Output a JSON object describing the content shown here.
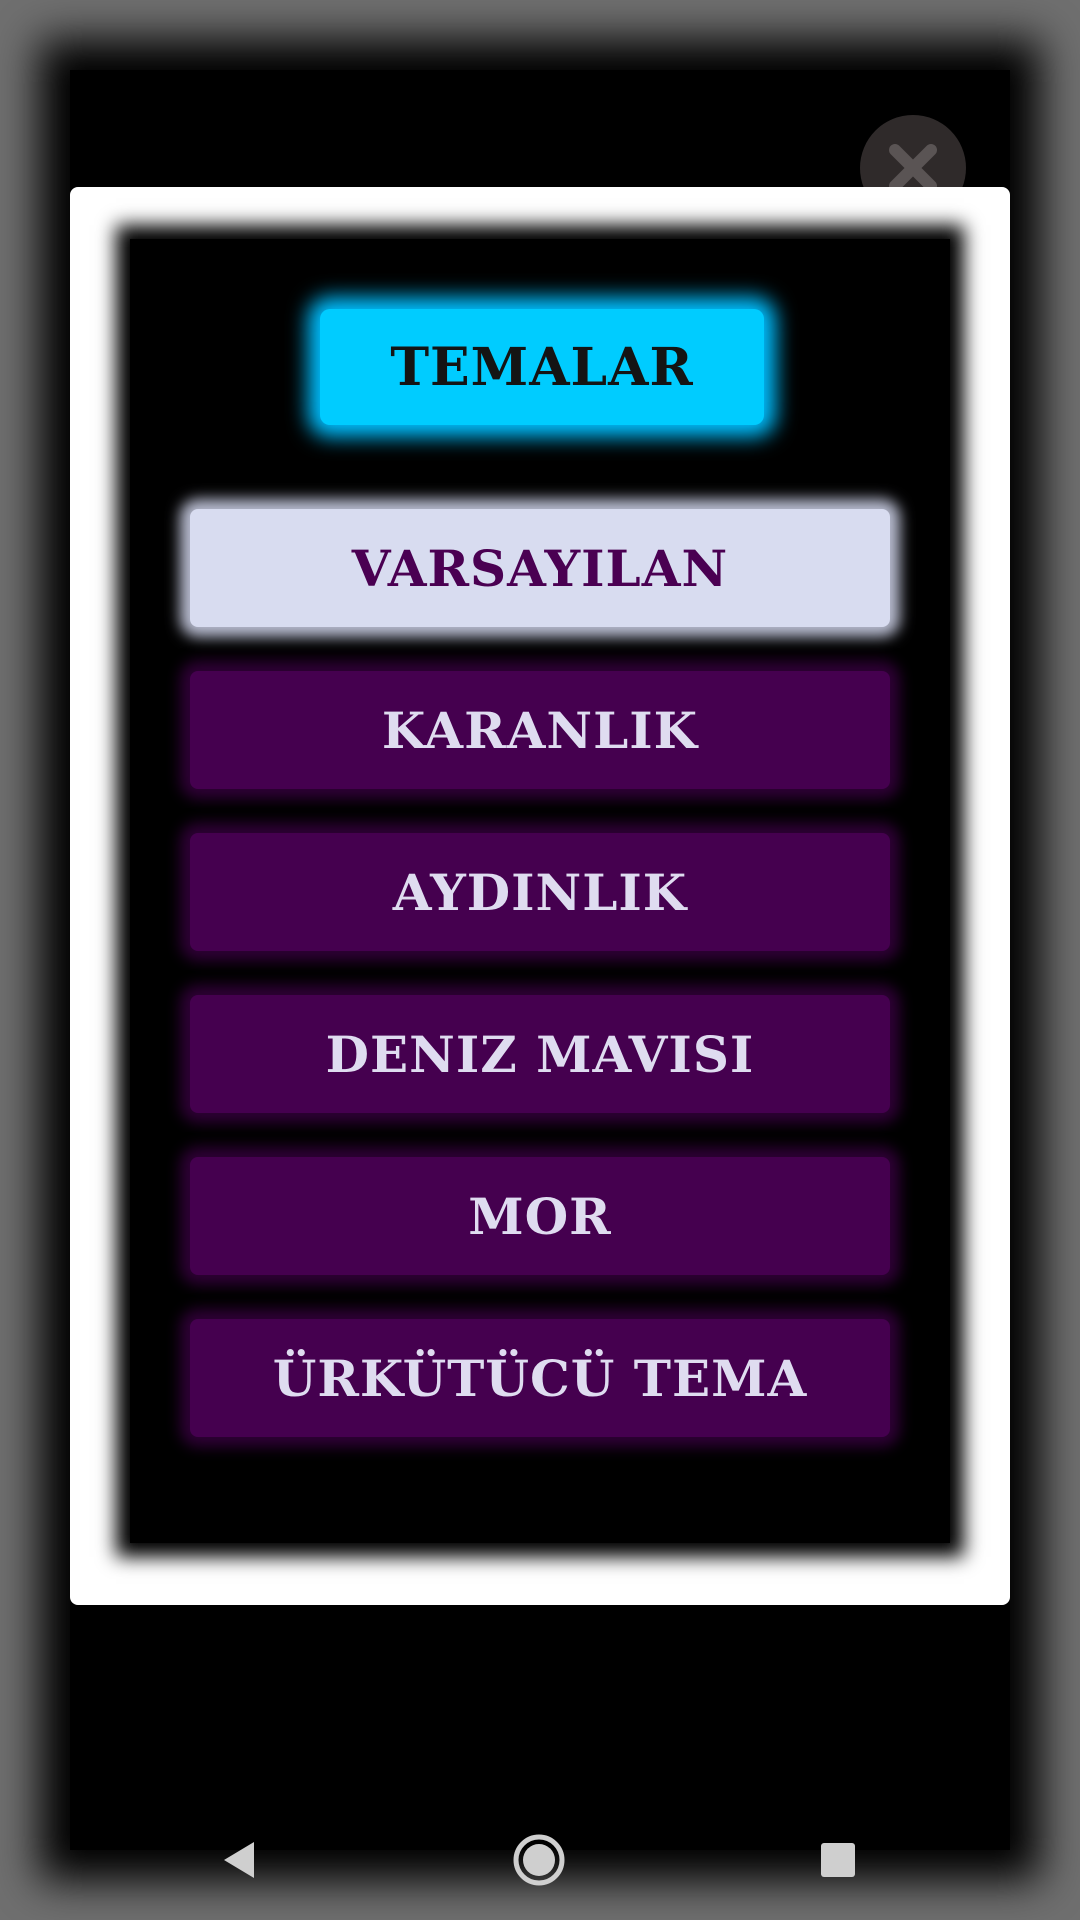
{
  "dialog": {
    "title": "TEMALAR",
    "themes": [
      {
        "label": "VARSAYILAN",
        "selected": true
      },
      {
        "label": "KARANLIK",
        "selected": false
      },
      {
        "label": "AYDINLIK",
        "selected": false
      },
      {
        "label": "DENIZ MAVISI",
        "selected": false
      },
      {
        "label": "MOR",
        "selected": false
      },
      {
        "label": "ÜRKÜTÜCÜ TEMA",
        "selected": false
      }
    ]
  },
  "icons": {
    "close": "close-icon",
    "back": "back-icon",
    "home": "home-icon",
    "recents": "recents-icon"
  },
  "colors": {
    "accent": "#00ccff",
    "button": "#45004f",
    "button_text": "#dfdcf0",
    "selected_button": "#d8dcf0",
    "selected_text": "#4a0052"
  }
}
